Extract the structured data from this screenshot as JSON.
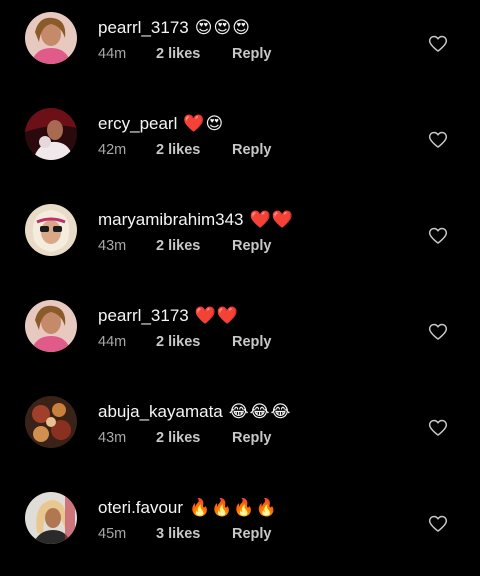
{
  "comments": [
    {
      "username": "pearrl_3173",
      "emojis": "😍😍😍",
      "time": "44m",
      "likes": "2 likes",
      "reply": "Reply",
      "avatar": "avatar-pink-top"
    },
    {
      "username": "ercy_pearl",
      "emojis": "❤️😍",
      "time": "42m",
      "likes": "2 likes",
      "reply": "Reply",
      "avatar": "avatar-dark-red"
    },
    {
      "username": "maryamibrahim343",
      "emojis": "❤️❤️",
      "time": "43m",
      "likes": "2 likes",
      "reply": "Reply",
      "avatar": "avatar-sunglasses"
    },
    {
      "username": "pearrl_3173",
      "emojis": "❤️❤️",
      "time": "44m",
      "likes": "2 likes",
      "reply": "Reply",
      "avatar": "avatar-pink-top"
    },
    {
      "username": "abuja_kayamata",
      "emojis": "😂😂😂",
      "time": "43m",
      "likes": "2 likes",
      "reply": "Reply",
      "avatar": "avatar-food"
    },
    {
      "username": "oteri.favour",
      "emojis": "🔥🔥🔥🔥",
      "time": "45m",
      "likes": "3 likes",
      "reply": "Reply",
      "avatar": "avatar-blonde"
    }
  ],
  "icons": {
    "like": "heart-outline-icon"
  },
  "colors": {
    "background": "#000000",
    "text": "#f5f5f5",
    "meta": "#a8a8a8"
  }
}
